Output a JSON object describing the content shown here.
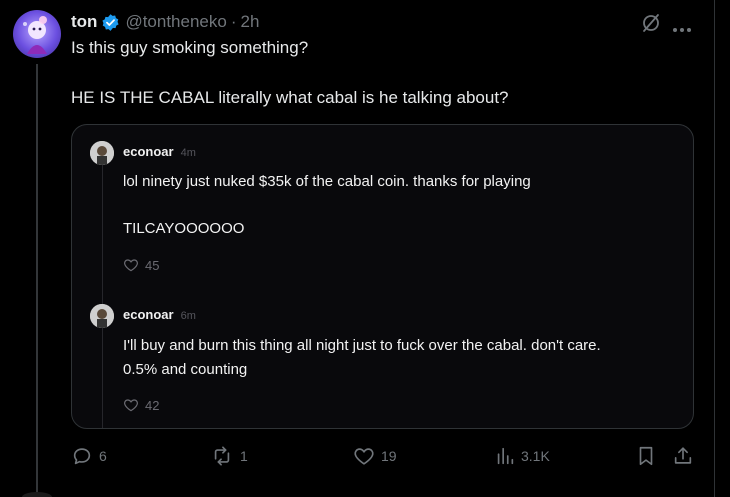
{
  "post": {
    "author_name": "ton",
    "author_handle": "@tontheneko",
    "separator": "·",
    "time": "2h",
    "text_line1": "Is this guy smoking something?",
    "text_line2": "HE IS THE CABAL literally what cabal is he talking about?"
  },
  "quote": {
    "replies": [
      {
        "author": "econoar",
        "time": "4m",
        "line1": "lol ninety just nuked $35k of the cabal coin. thanks for playing",
        "line2": "TILCAYOOOOOO",
        "likes": "45"
      },
      {
        "author": "econoar",
        "time": "6m",
        "line1": "I'll buy and burn this thing all night just to fuck over the cabal. don't care.",
        "line2": "0.5% and counting",
        "likes": "42"
      }
    ]
  },
  "actions": {
    "replies": "6",
    "reposts": "1",
    "likes": "19",
    "views": "3.1K"
  },
  "colors": {
    "background": "#000000",
    "text": "#e7e9ea",
    "muted": "#71767b",
    "verified": "#1d9bf0",
    "border": "#2f3336"
  },
  "icons": [
    "verified-badge-icon",
    "grok-icon",
    "more-icon",
    "heart-icon",
    "reply-icon",
    "repost-icon",
    "views-icon",
    "bookmark-icon",
    "share-icon"
  ]
}
